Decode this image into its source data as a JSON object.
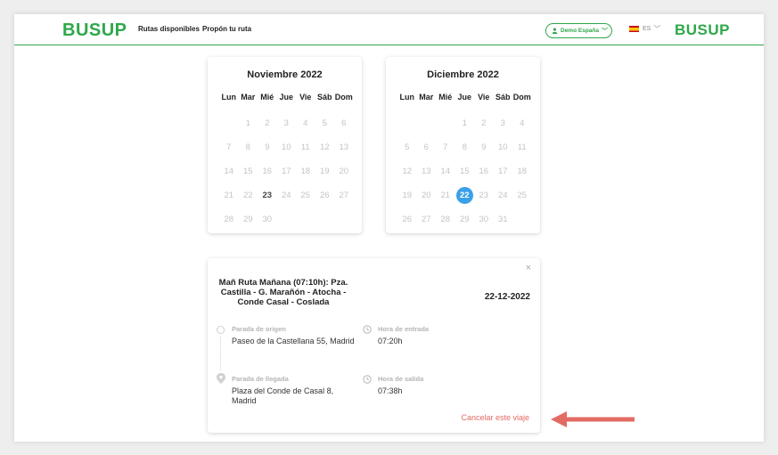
{
  "header": {
    "logo_left": "BUSUP",
    "logo_right": "BUSUP",
    "nav": [
      "Rutas disponibles",
      "Propón tu ruta"
    ],
    "user": "Demo España",
    "language": "ES",
    "accent_color": "#2ea84a"
  },
  "calendars": [
    {
      "title": "Noviembre 2022",
      "weekdays": [
        "Lun",
        "Mar",
        "Mié",
        "Jue",
        "Vie",
        "Sáb",
        "Dom"
      ],
      "offset": 1,
      "days": 30,
      "today": 23,
      "selected": null
    },
    {
      "title": "Diciembre 2022",
      "weekdays": [
        "Lun",
        "Mar",
        "Mié",
        "Jue",
        "Vie",
        "Sáb",
        "Dom"
      ],
      "offset": 3,
      "days": 31,
      "today": null,
      "selected": 22
    }
  ],
  "trip": {
    "close": "×",
    "route": "Mañ Ruta Mañana (07:10h): Pza. Castilla - G. Marañón - Atocha - Conde Casal - Coslada",
    "date": "22-12-2022",
    "origin_label": "Parada de origen",
    "origin_value": "Paseo de la Castellana 55, Madrid",
    "arrival_label": "Parada de llegada",
    "arrival_value": "Plaza del Conde de Casal 8, Madrid",
    "entry_label": "Hora de entrada",
    "entry_value": "07:20h",
    "exit_label": "Hora de salida",
    "exit_value": "07:38h",
    "cancel": "Cancelar este viaje",
    "cancel_color": "#e26b63"
  },
  "selected_color": "#3aa0e8",
  "arrow_color": "#e26b63"
}
